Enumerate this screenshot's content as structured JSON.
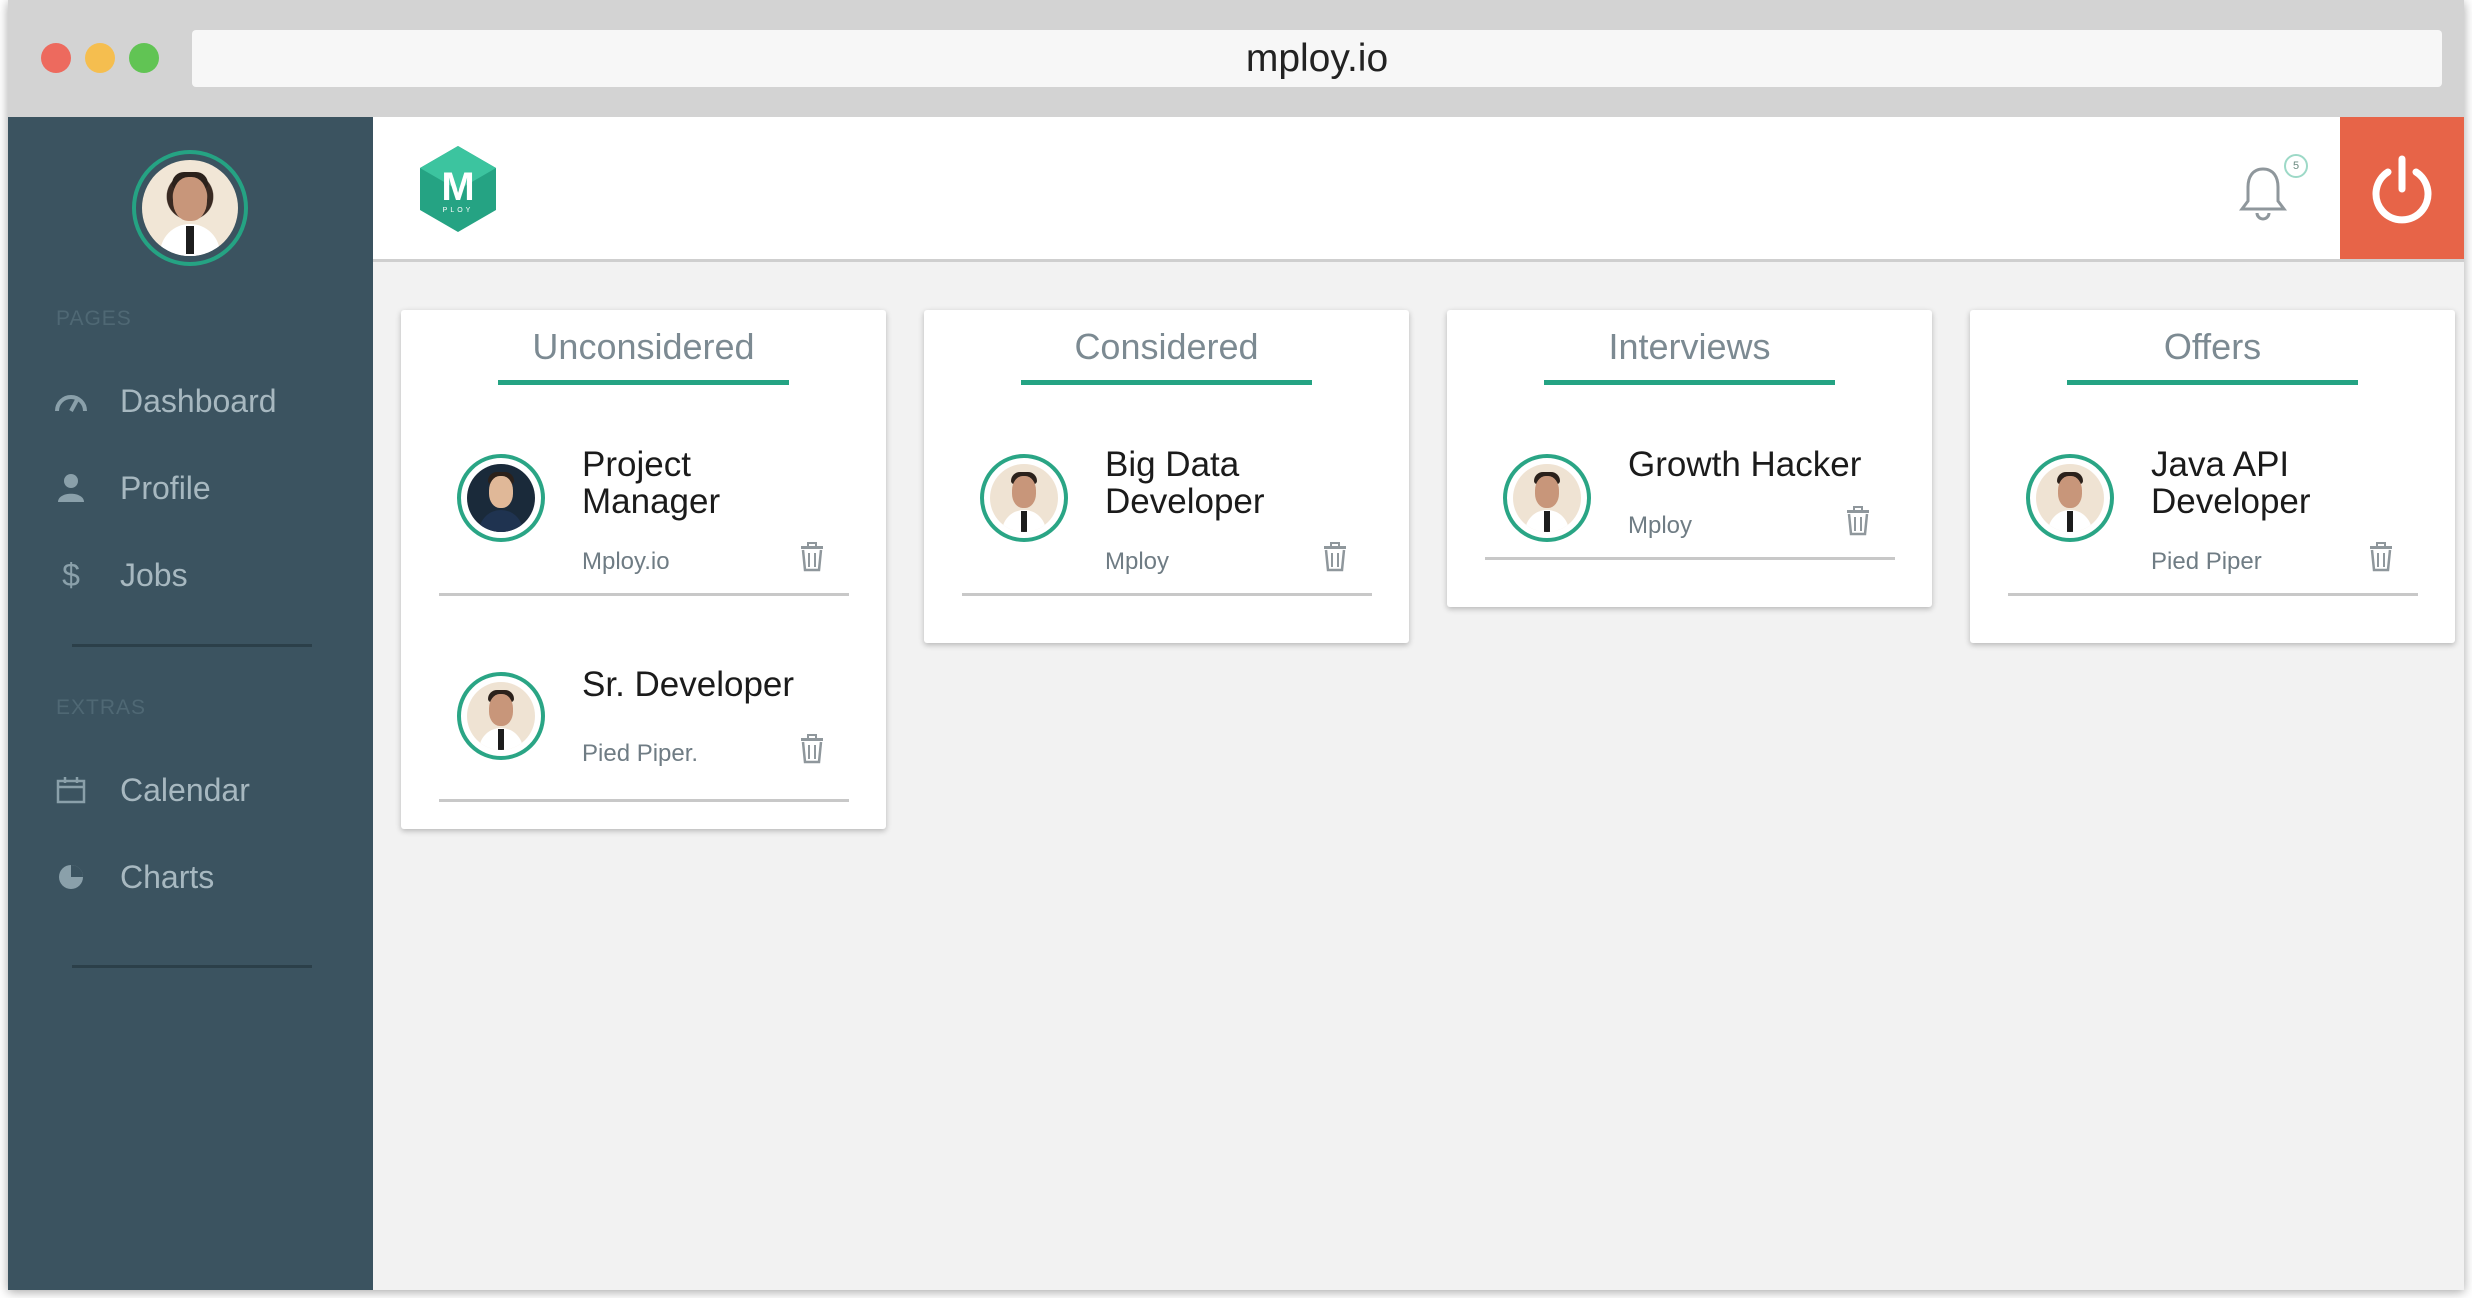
{
  "browser": {
    "url": "mploy.io"
  },
  "sidebar": {
    "sections": {
      "pages": "PAGES",
      "extras": "EXTRAS"
    },
    "items": [
      {
        "label": "Dashboard",
        "icon": "speedometer-icon"
      },
      {
        "label": "Profile",
        "icon": "person-icon"
      },
      {
        "label": "Jobs",
        "icon": "dollar-icon"
      },
      {
        "label": "Calendar",
        "icon": "calendar-icon"
      },
      {
        "label": "Charts",
        "icon": "pie-chart-icon"
      }
    ]
  },
  "header": {
    "logo_letter": "M",
    "logo_text": "PLOY",
    "notification_count": "5"
  },
  "colors": {
    "accent": "#24a383",
    "sidebar": "#3b5360",
    "power": "#e76448",
    "background": "#f2f2f2"
  },
  "board": {
    "columns": [
      {
        "title": "Unconsidered",
        "cards": [
          {
            "title": "Project Manager",
            "company": "Mploy.io"
          },
          {
            "title": "Sr. Developer",
            "company": "Pied Piper."
          }
        ]
      },
      {
        "title": "Considered",
        "cards": [
          {
            "title": "Big Data Developer",
            "company": "Mploy"
          }
        ]
      },
      {
        "title": "Interviews",
        "cards": [
          {
            "title": "Growth Hacker",
            "company": "Mploy"
          }
        ]
      },
      {
        "title": "Offers",
        "cards": [
          {
            "title": "Java API Developer",
            "company": "Pied Piper"
          }
        ]
      }
    ]
  }
}
